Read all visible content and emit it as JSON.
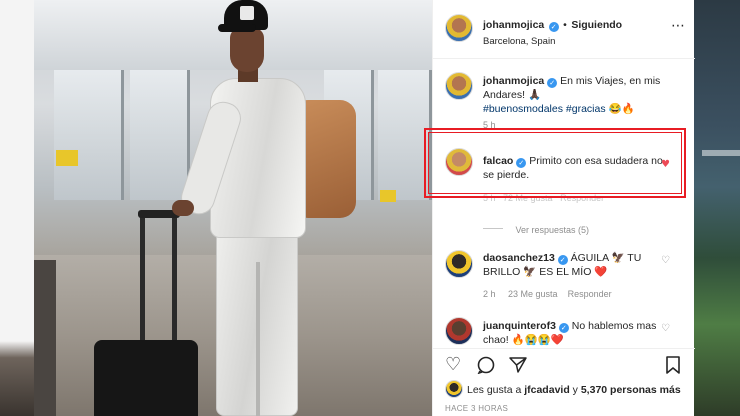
{
  "post": {
    "author": "johanmojica",
    "separator": "•",
    "follow_status": "Siguiendo",
    "location": "Barcelona, Spain",
    "more_icon": "more-horizontal-icon"
  },
  "caption": {
    "username": "johanmojica",
    "text": "En mis Viajes, en mis Andares! 🙏🏿",
    "hashtags": "#buenosmodales #gracias",
    "emojis": "😂🔥",
    "time": "5 h"
  },
  "comments": [
    {
      "username": "falcao",
      "text": "Primito con esa sudadera no se pierde.",
      "time": "5 h",
      "likes": "72 Me gusta",
      "reply": "Responder",
      "liked": true,
      "view_replies": "Ver respuestas (5)"
    },
    {
      "username": "daosanchez13",
      "text": "ÁGUILA 🦅 TU BRILLO 🦅 ES EL MÍO ❤️",
      "time": "2 h",
      "likes": "23 Me gusta",
      "reply": "Responder",
      "liked": false
    },
    {
      "username": "juanquinterof3",
      "text": "No hablemos mas chao! 🔥😭😭❤️",
      "liked": false
    }
  ],
  "likes_summary": {
    "prefix": "Les gusta a",
    "user": "jfcadavid",
    "connector": "y",
    "count": "5,370 personas más"
  },
  "timestamp": "HACE 3 HORAS",
  "colors": {
    "highlight": "#e81c24",
    "verified": "#3897f0",
    "liked_heart": "#ed4956"
  }
}
